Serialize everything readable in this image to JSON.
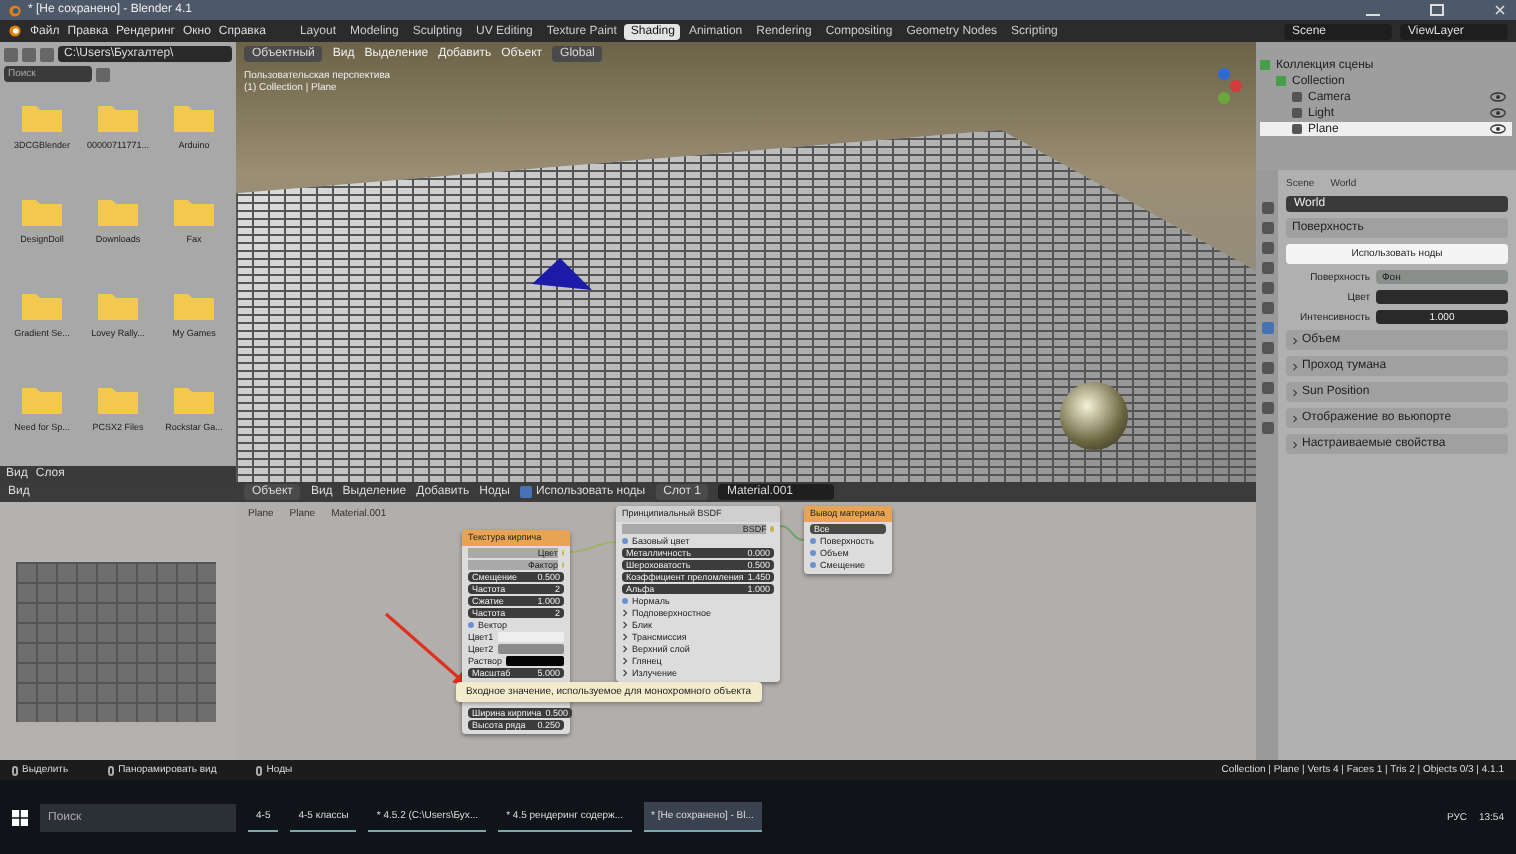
{
  "window": {
    "title": "* [Не сохранено] - Blender 4.1"
  },
  "menu": [
    "Файл",
    "Правка",
    "Рендеринг",
    "Окно",
    "Справка"
  ],
  "workspaces": [
    {
      "label": "Layout",
      "selected": false
    },
    {
      "label": "Modeling",
      "selected": false
    },
    {
      "label": "Sculpting",
      "selected": false
    },
    {
      "label": "UV Editing",
      "selected": false
    },
    {
      "label": "Texture Paint",
      "selected": false
    },
    {
      "label": "Shading",
      "selected": true
    },
    {
      "label": "Animation",
      "selected": false
    },
    {
      "label": "Rendering",
      "selected": false
    },
    {
      "label": "Compositing",
      "selected": false
    },
    {
      "label": "Geometry Nodes",
      "selected": false
    },
    {
      "label": "Scripting",
      "selected": false
    }
  ],
  "scene": "Scene",
  "view_layer": "ViewLayer",
  "file_browser": {
    "path": "C:\\Users\\Бухгалтер\\",
    "search_placeholder": "Поиск",
    "folders": [
      "3DCGBlender",
      "00000711771...",
      "Arduino",
      "DesignDoll",
      "Downloads",
      "Fax",
      "Gradient Se...",
      "Lovey Rally...",
      "My Games",
      "Need for Sp...",
      "PCSX2 Files",
      "Rockstar Ga..."
    ],
    "footer": [
      "Вид",
      "Слоя"
    ]
  },
  "viewport": {
    "mode": "Объектный",
    "menu": [
      "Вид",
      "Выделение",
      "Добавить",
      "Объект"
    ],
    "orientation": "Global",
    "view_name": "Пользовательская перспектива",
    "context": "(1) Collection | Plane"
  },
  "outliner": {
    "root": "Коллекция сцены",
    "items": [
      {
        "label": "Collection",
        "selected": false,
        "children": [
          {
            "label": "Camera",
            "selected": false
          },
          {
            "label": "Light",
            "selected": false
          },
          {
            "label": "Plane",
            "selected": true
          }
        ]
      }
    ]
  },
  "properties": {
    "breadcrumb": [
      "Scene",
      "World"
    ],
    "world": "World",
    "surface_header": "Поверхность",
    "use_nodes": "Использовать ноды",
    "fields": [
      {
        "kind": "shader",
        "label": "Поверхность",
        "value": "Фон"
      },
      {
        "kind": "color",
        "label": "Цвет",
        "color": "#2b2b2b"
      },
      {
        "kind": "number",
        "label": "Интенсивность",
        "value": "1.000"
      }
    ],
    "sections": [
      "Объем",
      "Проход тумана",
      "Sun Position",
      "Отображение во вьюпорте",
      "Настраиваемые свойства"
    ]
  },
  "image_editor": {
    "menu": "Вид"
  },
  "node_editor": {
    "mode": "Объект",
    "menu": [
      "Вид",
      "Выделение",
      "Добавить",
      "Ноды"
    ],
    "use_nodes": {
      "label": "Использовать ноды",
      "checked": true
    },
    "slot": "Слот 1",
    "material": "Material.001",
    "breadcrumb": [
      "Plane",
      "Plane",
      "Material.001"
    ],
    "nodes": [
      {
        "title": "Текстура кирпича",
        "rows": [
          {
            "kind": "output",
            "label": "Цвет"
          },
          {
            "kind": "output",
            "label": "Фактор"
          },
          {
            "kind": "field",
            "label": "Смещение",
            "value": "0.500"
          },
          {
            "kind": "field",
            "label": "Частота",
            "value": "2"
          },
          {
            "kind": "field",
            "label": "Сжатие",
            "value": "1.000"
          },
          {
            "kind": "field",
            "label": "Частота",
            "value": "2"
          },
          {
            "kind": "input",
            "label": "Вектор"
          },
          {
            "kind": "color",
            "label": "Цвет1",
            "color": "#eeeeee"
          },
          {
            "kind": "color",
            "label": "Цвет2",
            "color": "#8a8a8a"
          },
          {
            "kind": "color",
            "label": "Раствор",
            "color": "#050505"
          },
          {
            "kind": "field",
            "label": "Масштаб",
            "value": "5.000"
          },
          {
            "kind": "field",
            "label": "Ширина кирпича",
            "value": "0.500"
          },
          {
            "kind": "field",
            "label": "Высота ряда",
            "value": "0.250"
          }
        ]
      },
      {
        "title": "Принципиальный BSDF",
        "rows": [
          {
            "kind": "output",
            "label": "BSDF"
          },
          {
            "kind": "input",
            "label": "Базовый цвет"
          },
          {
            "kind": "field",
            "label": "Металличность",
            "value": "0.000"
          },
          {
            "kind": "field",
            "label": "Шероховатость",
            "value": "0.500"
          },
          {
            "kind": "field",
            "label": "Коэффициент преломления",
            "value": "1.450"
          },
          {
            "kind": "field",
            "label": "Альфа",
            "value": "1.000"
          },
          {
            "kind": "input",
            "label": "Нормаль"
          },
          {
            "kind": "panel",
            "label": "Подповерхностное"
          },
          {
            "kind": "panel",
            "label": "Блик"
          },
          {
            "kind": "panel",
            "label": "Трансмиссия"
          },
          {
            "kind": "panel",
            "label": "Верхний слой"
          },
          {
            "kind": "panel",
            "label": "Глянец"
          },
          {
            "kind": "panel",
            "label": "Излучение"
          }
        ]
      },
      {
        "title": "Вывод материала",
        "rows": [
          {
            "kind": "select",
            "label": "Все"
          },
          {
            "kind": "input",
            "label": "Поверхность"
          },
          {
            "kind": "input",
            "label": "Объем"
          },
          {
            "kind": "input",
            "label": "Смещение"
          }
        ]
      }
    ],
    "tooltip": "Входное значение, используемое для монохромного объекта"
  },
  "status_bar": {
    "hints": [
      "Выделить",
      "Панорамировать вид",
      "Ноды"
    ],
    "stats": "Collection | Plane | Verts 4 | Faces 1 | Tris 2 | Objects 0/3 | 4.1.1"
  },
  "taskbar": {
    "search_placeholder": "Поиск",
    "apps": [
      {
        "label": "4-5",
        "selected": false
      },
      {
        "label": "4-5 классы",
        "selected": false
      },
      {
        "label": "* 4.5.2 (C:\\Users\\Бух...",
        "selected": false
      },
      {
        "label": "* 4.5 рендеринг содерж...",
        "selected": false
      },
      {
        "label": "* [Не сохранено] - Bl...",
        "selected": true
      }
    ],
    "language": "РУС",
    "time": "13:54"
  }
}
